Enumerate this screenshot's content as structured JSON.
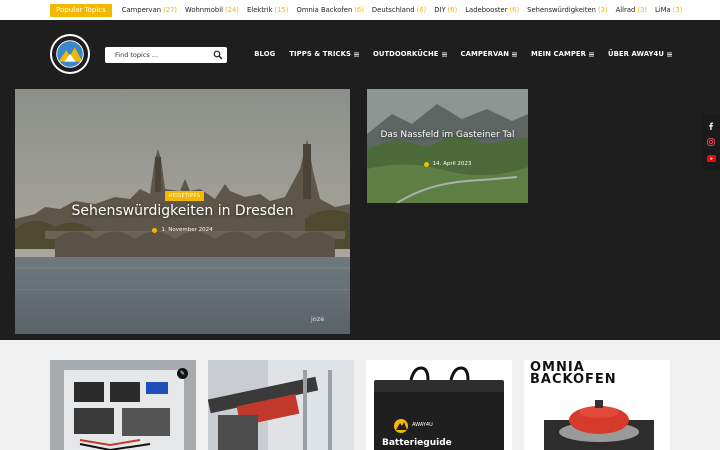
{
  "topbar": {
    "popular_label": "Popular Topics",
    "topics": [
      {
        "name": "Campervan",
        "count": "(27)"
      },
      {
        "name": "Wohnmobil",
        "count": "(24)"
      },
      {
        "name": "Elektrik",
        "count": "(15)"
      },
      {
        "name": "Omnia Backofen",
        "count": "(6)"
      },
      {
        "name": "Deutschland",
        "count": "(6)"
      },
      {
        "name": "DIY",
        "count": "(6)"
      },
      {
        "name": "Ladebooster",
        "count": "(6)"
      },
      {
        "name": "Sehenswürdigkeiten",
        "count": "(3)"
      },
      {
        "name": "Allrad",
        "count": "(3)"
      },
      {
        "name": "LiMa",
        "count": "(3)"
      }
    ]
  },
  "header": {
    "search_placeholder": "Find topics ...",
    "nav": [
      "BLOG",
      "TIPPS & TRICKS",
      "OUTDOORKÜCHE",
      "CAMPERVAN",
      "MEIN CAMPER",
      "ÜBER AWAY4U"
    ]
  },
  "hero_main": {
    "badge": "REISETIPPS",
    "title": "Sehenswürdigkeiten in Dresden",
    "date": "1. November 2024",
    "credit": "joze"
  },
  "hero_side": {
    "title": "Das Nassfeld im Gasteiner Tal",
    "date": "14. April 2023"
  },
  "social": [
    "facebook-icon",
    "instagram-icon",
    "youtube-icon"
  ],
  "cards": {
    "card4_line1": "OMNIA",
    "card4_line2": "BACKOFEN",
    "card3_label": "Batterieguide",
    "card3_brand": "AWAY4U"
  },
  "colors": {
    "accent": "#f5b800",
    "dark": "#1e1e1e"
  }
}
